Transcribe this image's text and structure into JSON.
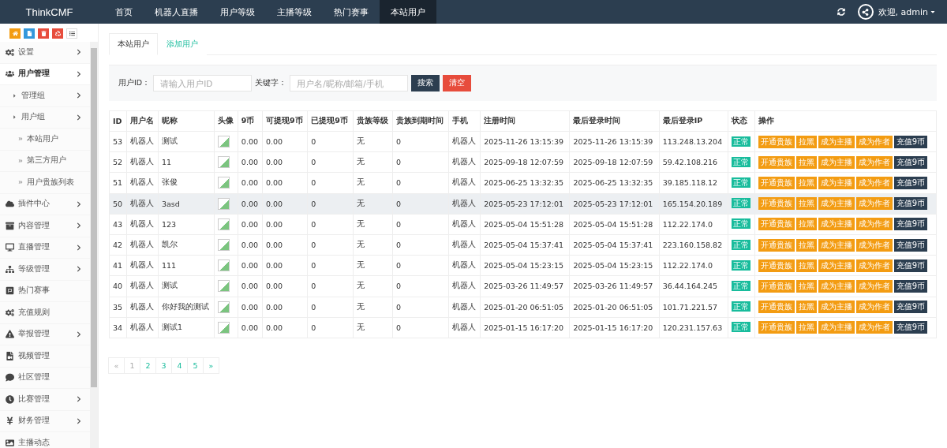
{
  "brand": "ThinkCMF",
  "nav": [
    {
      "label": "首页",
      "selected": false
    },
    {
      "label": "机器人直播",
      "selected": false
    },
    {
      "label": "用户等级",
      "selected": false
    },
    {
      "label": "主播等级",
      "selected": false
    },
    {
      "label": "热门赛事",
      "selected": false
    },
    {
      "label": "本站用户",
      "selected": true
    }
  ],
  "user_menu": {
    "label": "欢迎, admin"
  },
  "sidebar": {
    "items": [
      {
        "label": "设置",
        "expandable": true,
        "selected": false
      },
      {
        "label": "用户管理",
        "expandable": true,
        "selected": true,
        "children": [
          {
            "label": "管理组",
            "expandable": true,
            "selected": false
          },
          {
            "label": "用户组",
            "expandable": true,
            "selected": false,
            "children": [
              {
                "label": "本站用户",
                "expandable": false,
                "selected": false
              },
              {
                "label": "第三方用户",
                "expandable": false,
                "selected": false
              },
              {
                "label": "用户贵族列表",
                "expandable": false,
                "selected": false
              }
            ]
          }
        ]
      },
      {
        "label": "插件中心",
        "expandable": true,
        "selected": false
      },
      {
        "label": "内容管理",
        "expandable": true,
        "selected": false
      },
      {
        "label": "直播管理",
        "expandable": true,
        "selected": false
      },
      {
        "label": "等级管理",
        "expandable": true,
        "selected": false
      },
      {
        "label": "热门赛事",
        "expandable": false,
        "selected": false
      },
      {
        "label": "充值规则",
        "expandable": false,
        "selected": false
      },
      {
        "label": "举报管理",
        "expandable": true,
        "selected": false
      },
      {
        "label": "视频管理",
        "expandable": false,
        "selected": false
      },
      {
        "label": "社区管理",
        "expandable": false,
        "selected": false
      },
      {
        "label": "比赛管理",
        "expandable": true,
        "selected": false
      },
      {
        "label": "财务管理",
        "expandable": true,
        "selected": false
      },
      {
        "label": "主播动态",
        "expandable": false,
        "selected": false
      }
    ]
  },
  "tabs": [
    {
      "label": "本站用户",
      "selected": true
    },
    {
      "label": "添加用户",
      "selected": false
    }
  ],
  "filter": {
    "id_label": "用户ID：",
    "id_placeholder": "请输入用户ID",
    "keyword_label": "关键字：",
    "keyword_placeholder": "用户名/昵称/邮箱/手机",
    "search": "搜索",
    "clear": "清空"
  },
  "table": {
    "columns": [
      "ID",
      "用户名",
      "昵称",
      "头像",
      "9币",
      "可提现9币",
      "已提现9币",
      "贵族等级",
      "贵族到期时间",
      "手机",
      "注册时间",
      "最后登录时间",
      "最后登录IP",
      "状态",
      "操作"
    ],
    "rows": [
      {
        "id": "53",
        "username": "机器人",
        "nickname": "测试",
        "coins": "0.00",
        "withdrawable": "0.00",
        "withdrawn": "0",
        "noble": "无",
        "noble_expire": "0",
        "phone": "机器人",
        "registered": "2025-11-26 13:15:39",
        "last_login": "2025-11-26 13:15:39",
        "ip": "113.248.13.204",
        "status": "正常",
        "highlighted": false,
        "actions": [
          {
            "label": "开通贵族",
            "kind": "warning"
          },
          {
            "label": "拉黑",
            "kind": "warning"
          },
          {
            "label": "成为主播",
            "kind": "warning"
          },
          {
            "label": "成为作者",
            "kind": "warning"
          },
          {
            "label": "充值9币",
            "kind": "dark"
          }
        ]
      },
      {
        "id": "52",
        "username": "机器人",
        "nickname": "11",
        "coins": "0.00",
        "withdrawable": "0.00",
        "withdrawn": "0",
        "noble": "无",
        "noble_expire": "0",
        "phone": "机器人",
        "registered": "2025-09-18 12:07:59",
        "last_login": "2025-09-18 12:07:59",
        "ip": "59.42.108.216",
        "status": "正常",
        "highlighted": false,
        "actions": [
          {
            "label": "开通贵族",
            "kind": "warning"
          },
          {
            "label": "拉黑",
            "kind": "warning"
          },
          {
            "label": "成为主播",
            "kind": "warning"
          },
          {
            "label": "成为作者",
            "kind": "warning"
          },
          {
            "label": "充值9币",
            "kind": "dark"
          }
        ]
      },
      {
        "id": "51",
        "username": "机器人",
        "nickname": "张俊",
        "coins": "0.00",
        "withdrawable": "0.00",
        "withdrawn": "0",
        "noble": "无",
        "noble_expire": "0",
        "phone": "机器人",
        "registered": "2025-06-25 13:32:35",
        "last_login": "2025-06-25 13:32:35",
        "ip": "39.185.118.12",
        "status": "正常",
        "highlighted": false,
        "actions": [
          {
            "label": "开通贵族",
            "kind": "warning"
          },
          {
            "label": "拉黑",
            "kind": "warning"
          },
          {
            "label": "成为主播",
            "kind": "warning"
          },
          {
            "label": "成为作者",
            "kind": "warning"
          },
          {
            "label": "充值9币",
            "kind": "dark"
          }
        ]
      },
      {
        "id": "50",
        "username": "机器人",
        "nickname": "3asd",
        "coins": "0.00",
        "withdrawable": "0.00",
        "withdrawn": "0",
        "noble": "无",
        "noble_expire": "0",
        "phone": "机器人",
        "registered": "2025-05-23 17:12:01",
        "last_login": "2025-05-23 17:12:01",
        "ip": "165.154.20.189",
        "status": "正常",
        "highlighted": true,
        "actions": [
          {
            "label": "开通贵族",
            "kind": "warning"
          },
          {
            "label": "拉黑",
            "kind": "warning"
          },
          {
            "label": "成为主播",
            "kind": "warning"
          },
          {
            "label": "成为作者",
            "kind": "warning"
          },
          {
            "label": "充值9币",
            "kind": "dark"
          }
        ]
      },
      {
        "id": "43",
        "username": "机器人",
        "nickname": "123",
        "coins": "0.00",
        "withdrawable": "0.00",
        "withdrawn": "0",
        "noble": "无",
        "noble_expire": "0",
        "phone": "机器人",
        "registered": "2025-05-04 15:51:28",
        "last_login": "2025-05-04 15:51:28",
        "ip": "112.22.174.0",
        "status": "正常",
        "highlighted": false,
        "actions": [
          {
            "label": "开通贵族",
            "kind": "warning"
          },
          {
            "label": "拉黑",
            "kind": "warning"
          },
          {
            "label": "成为主播",
            "kind": "warning"
          },
          {
            "label": "成为作者",
            "kind": "warning"
          },
          {
            "label": "充值9币",
            "kind": "dark"
          }
        ]
      },
      {
        "id": "42",
        "username": "机器人",
        "nickname": "凯尔",
        "coins": "0.00",
        "withdrawable": "0.00",
        "withdrawn": "0",
        "noble": "无",
        "noble_expire": "0",
        "phone": "机器人",
        "registered": "2025-05-04 15:37:41",
        "last_login": "2025-05-04 15:37:41",
        "ip": "223.160.158.82",
        "status": "正常",
        "highlighted": false,
        "actions": [
          {
            "label": "开通贵族",
            "kind": "warning"
          },
          {
            "label": "拉黑",
            "kind": "warning"
          },
          {
            "label": "成为主播",
            "kind": "warning"
          },
          {
            "label": "成为作者",
            "kind": "warning"
          },
          {
            "label": "充值9币",
            "kind": "dark"
          }
        ]
      },
      {
        "id": "41",
        "username": "机器人",
        "nickname": "111",
        "coins": "0.00",
        "withdrawable": "0.00",
        "withdrawn": "0",
        "noble": "无",
        "noble_expire": "0",
        "phone": "机器人",
        "registered": "2025-05-04 15:23:15",
        "last_login": "2025-05-04 15:23:15",
        "ip": "112.22.174.0",
        "status": "正常",
        "highlighted": false,
        "actions": [
          {
            "label": "开通贵族",
            "kind": "warning"
          },
          {
            "label": "拉黑",
            "kind": "warning"
          },
          {
            "label": "成为主播",
            "kind": "warning"
          },
          {
            "label": "成为作者",
            "kind": "warning"
          },
          {
            "label": "充值9币",
            "kind": "dark"
          }
        ]
      },
      {
        "id": "40",
        "username": "机器人",
        "nickname": "测试",
        "coins": "0.00",
        "withdrawable": "0.00",
        "withdrawn": "0",
        "noble": "无",
        "noble_expire": "0",
        "phone": "机器人",
        "registered": "2025-03-26 11:49:57",
        "last_login": "2025-03-26 11:49:57",
        "ip": "36.44.164.245",
        "status": "正常",
        "highlighted": false,
        "actions": [
          {
            "label": "开通贵族",
            "kind": "warning"
          },
          {
            "label": "拉黑",
            "kind": "warning"
          },
          {
            "label": "成为主播",
            "kind": "warning"
          },
          {
            "label": "成为作者",
            "kind": "warning"
          },
          {
            "label": "充值9币",
            "kind": "dark"
          }
        ]
      },
      {
        "id": "35",
        "username": "机器人",
        "nickname": "你好我的测试",
        "coins": "0.00",
        "withdrawable": "0.00",
        "withdrawn": "0",
        "noble": "无",
        "noble_expire": "0",
        "phone": "机器人",
        "registered": "2025-01-20 06:51:05",
        "last_login": "2025-01-20 06:51:05",
        "ip": "101.71.221.57",
        "status": "正常",
        "highlighted": false,
        "actions": [
          {
            "label": "开通贵族",
            "kind": "warning"
          },
          {
            "label": "拉黑",
            "kind": "warning"
          },
          {
            "label": "成为主播",
            "kind": "warning"
          },
          {
            "label": "成为作者",
            "kind": "warning"
          },
          {
            "label": "充值9币",
            "kind": "dark"
          }
        ]
      },
      {
        "id": "34",
        "username": "机器人",
        "nickname": "测试1",
        "coins": "0.00",
        "withdrawable": "0.00",
        "withdrawn": "0",
        "noble": "无",
        "noble_expire": "0",
        "phone": "机器人",
        "registered": "2025-01-15 16:17:20",
        "last_login": "2025-01-15 16:17:20",
        "ip": "120.231.157.63",
        "status": "正常",
        "highlighted": false,
        "actions": [
          {
            "label": "开通贵族",
            "kind": "warning"
          },
          {
            "label": "拉黑",
            "kind": "warning"
          },
          {
            "label": "成为主播",
            "kind": "warning"
          },
          {
            "label": "成为作者",
            "kind": "warning"
          },
          {
            "label": "充值9币",
            "kind": "dark"
          }
        ]
      }
    ]
  },
  "pagination": [
    {
      "label": "«",
      "disabled": true
    },
    {
      "label": "1",
      "disabled": true
    },
    {
      "label": "2",
      "disabled": false
    },
    {
      "label": "3",
      "disabled": false
    },
    {
      "label": "4",
      "disabled": false
    },
    {
      "label": "5",
      "disabled": false
    },
    {
      "label": "»",
      "disabled": false
    }
  ]
}
